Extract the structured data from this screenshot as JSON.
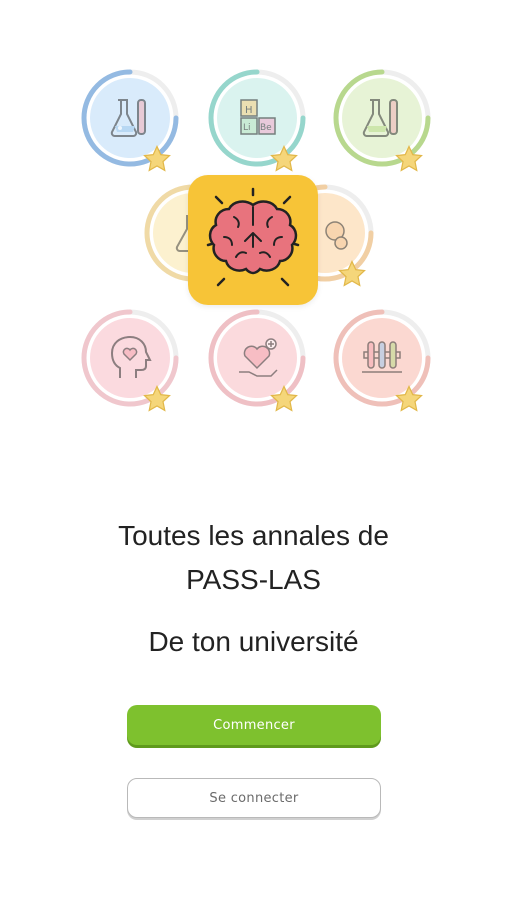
{
  "hero": {
    "badges": [
      {
        "name": "chemistry-flask-icon",
        "color": "#4a90d9",
        "bg": "#d9ebfb"
      },
      {
        "name": "periodic-table-icon",
        "color": "#4fc3b0",
        "bg": "#daf3ef"
      },
      {
        "name": "chemistry-flask-icon",
        "color": "#8cc63f",
        "bg": "#e7f3d6"
      },
      {
        "name": "flask-icon",
        "color": "#f2c14e",
        "bg": "#fcf1cf"
      },
      {
        "name": "molecule-icon",
        "color": "#f5a94a",
        "bg": "#fde6c9"
      },
      {
        "name": "mind-heart-icon",
        "color": "#f28b9a",
        "bg": "#fbdadf"
      },
      {
        "name": "hand-heart-icon",
        "color": "#f07b86",
        "bg": "#fbdadd"
      },
      {
        "name": "test-tubes-icon",
        "color": "#ef7a6a",
        "bg": "#fbd8d1"
      }
    ],
    "logo": {
      "name": "brain-icon",
      "bg": "#f7c437",
      "brain_color": "#e8737d"
    }
  },
  "headline": {
    "line1": "Toutes les annales de",
    "line2": "PASS-LAS",
    "line3": "De ton université"
  },
  "actions": {
    "start_label": "Commencer",
    "login_label": "Se connecter",
    "start_color": "#7ec12e"
  }
}
